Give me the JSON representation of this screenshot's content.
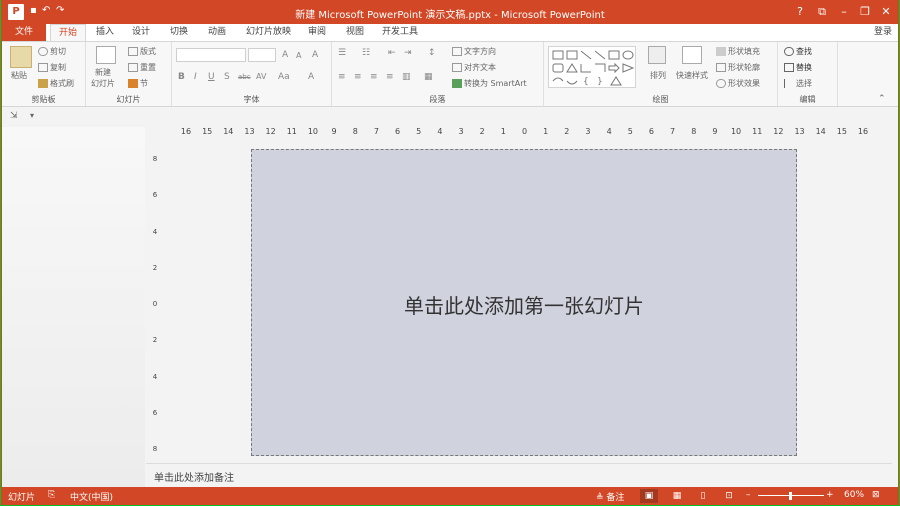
{
  "window": {
    "title": "新建 Microsoft PowerPoint 演示文稿.pptx - Microsoft PowerPoint",
    "help": "?",
    "minimize": "–",
    "restore": "❐",
    "close": "✕",
    "ribbon_options": "⧉"
  },
  "tabs": {
    "file": "文件",
    "items": [
      "开始",
      "插入",
      "设计",
      "切换",
      "动画",
      "幻灯片放映",
      "审阅",
      "视图",
      "开发工具"
    ],
    "login": "登录"
  },
  "ribbon": {
    "clipboard": {
      "label": "剪贴板",
      "paste": "粘贴",
      "cut": "剪切",
      "copy": "复制",
      "format_painter": "格式刷"
    },
    "slides": {
      "label": "幻灯片",
      "new_slide_line1": "新建",
      "new_slide_line2": "幻灯片",
      "layout": "版式",
      "reset": "重置",
      "section": "节"
    },
    "font": {
      "label": "字体",
      "bold": "B",
      "italic": "I",
      "underline": "U",
      "shadow": "S",
      "strike": "abc",
      "spacing": "AV",
      "case": "Aa",
      "color": "A",
      "grow": "A",
      "shrink": "A",
      "clear": "A"
    },
    "paragraph": {
      "label": "段落",
      "text_direction": "文字方向",
      "align_text": "对齐文本",
      "smartart": "转换为 SmartArt"
    },
    "drawing": {
      "label": "绘图",
      "arrange": "排列",
      "quick_styles": "快速样式",
      "shape_fill": "形状填充",
      "shape_outline": "形状轮廓",
      "shape_effects": "形状效果"
    },
    "editing": {
      "label": "编辑",
      "find": "查找",
      "replace": "替换",
      "select": "选择"
    }
  },
  "ruler": {
    "h": [
      "16",
      "15",
      "14",
      "13",
      "12",
      "11",
      "10",
      "9",
      "8",
      "7",
      "6",
      "5",
      "4",
      "3",
      "2",
      "1",
      "0",
      "1",
      "2",
      "3",
      "4",
      "5",
      "6",
      "7",
      "8",
      "9",
      "10",
      "11",
      "12",
      "13",
      "14",
      "15",
      "16"
    ],
    "v": [
      "8",
      "6",
      "4",
      "2",
      "0",
      "2",
      "4",
      "6",
      "8"
    ]
  },
  "slide": {
    "placeholder": "单击此处添加第一张幻灯片"
  },
  "notes": {
    "placeholder": "单击此处添加备注"
  },
  "status": {
    "slide_label": "幻灯片",
    "language": "中文(中国)",
    "notes": "备注",
    "zoom": "60%"
  }
}
